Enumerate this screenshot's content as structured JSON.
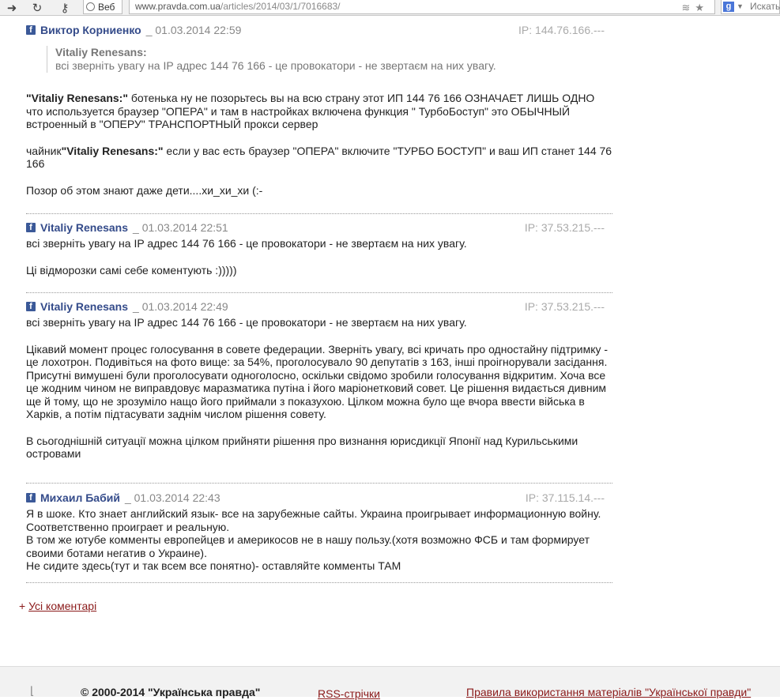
{
  "browser": {
    "web_label": "Веб",
    "url_host": "www.pravda.com.ua",
    "url_path": "/articles/2014/03/1/7016683/",
    "search_placeholder": "Искать",
    "search_engine_badge": "g"
  },
  "comments": [
    {
      "author": "Виктор Корниенко",
      "date": "_ 01.03.2014 22:59",
      "ip": "IP: 144.76.166.---",
      "quote_author": "Vitaliy Renesans:",
      "quote_text": "всі зверніть увагу на IP адрес 144 76 166 - це провокатори - не звертаєм на них увагу.",
      "p1_bold": "\"Vitaliy Renesans:\"",
      "p1_text": " ботенька ну не позорьтесь вы на всю страну этот ИП 144 76 166 ОЗНАЧАЕТ ЛИШЬ ОДНО что используется браузер \"ОПЕРА\" и там в настройках включена функция \" ТурбоБоступ\" это ОБЫЧНЫЙ встроенный в \"ОПЕРУ\" ТРАНСПОРТНЫЙ прокси сервер",
      "p2_pre": "чайник",
      "p2_bold": "\"Vitaliy Renesans:\"",
      "p2_text": " если у вас есть браузер \"ОПЕРА\" включите \"ТУРБО БОСТУП\" и ваш ИП станет 144 76 166",
      "p3": "Позор об этом знают даже дети....хи_хи_хи (:-"
    },
    {
      "author": "Vitaliy Renesans",
      "date": "_ 01.03.2014 22:51",
      "ip": "IP: 37.53.215.---",
      "p1": "всі зверніть увагу на IP адрес 144 76 166 - це провокатори - не звертаєм на них увагу.",
      "p2": "Ці відморозки самі себе коментують :)))))"
    },
    {
      "author": "Vitaliy Renesans",
      "date": "_ 01.03.2014 22:49",
      "ip": "IP: 37.53.215.---",
      "p1": "всі зверніть увагу на IP адрес 144 76 166 - це провокатори - не звертаєм на них увагу.",
      "p2": "Цікавий момент процес голосування в совете федерации. Зверніть увагу, всі кричать про одностайну підтримку - це лохотрон. Подивіться на фото вище: за 54%, проголосувало 90 депутатів з 163, інші проігнорували засідання. Присутні вимушені були проголосувати одноголосно, оскільки свідомо зробили голосування відкритим. Хоча все це жодним чином не виправдовує маразматика путіна і його маріонетковий совет. Це рішення видається дивним ще й тому, що не зрозуміло нащо його приймали з показухою. Цілком можна було ще вчора ввести війська в Харків, а потім підтасувати заднім числом рішення совету.",
      "p3": "В сьогоднішній ситуації можна цілком прийняти рішення про визнання юрисдикції Японії над Курильськими островами"
    },
    {
      "author": "Михаил Бабий",
      "date": "_ 01.03.2014 22:43",
      "ip": "IP: 37.115.14.---",
      "p1": "Я в шоке. Кто знает английский язык- все на зарубежные сайты. Украина проигрывает информационную войну. Соответственно проигрaет и реальную.",
      "p2": "В том же ютубе комменты европейцев и америкосов не в нашу пользу.(хотя возможно ФСБ и там формирует своими ботами негатив о Украине).",
      "p3": "Не сидите здесь(тут и так всем все понятно)- оставляйте комменты ТАМ"
    }
  ],
  "all_comments": {
    "plus": "+",
    "label": "Усі коментарі"
  },
  "footer": {
    "copyright": "© 2000-2014 \"Українська правда\"",
    "rss": "RSS-стрічки",
    "rules": "Правила використання матеріалів \"Української правди\""
  }
}
